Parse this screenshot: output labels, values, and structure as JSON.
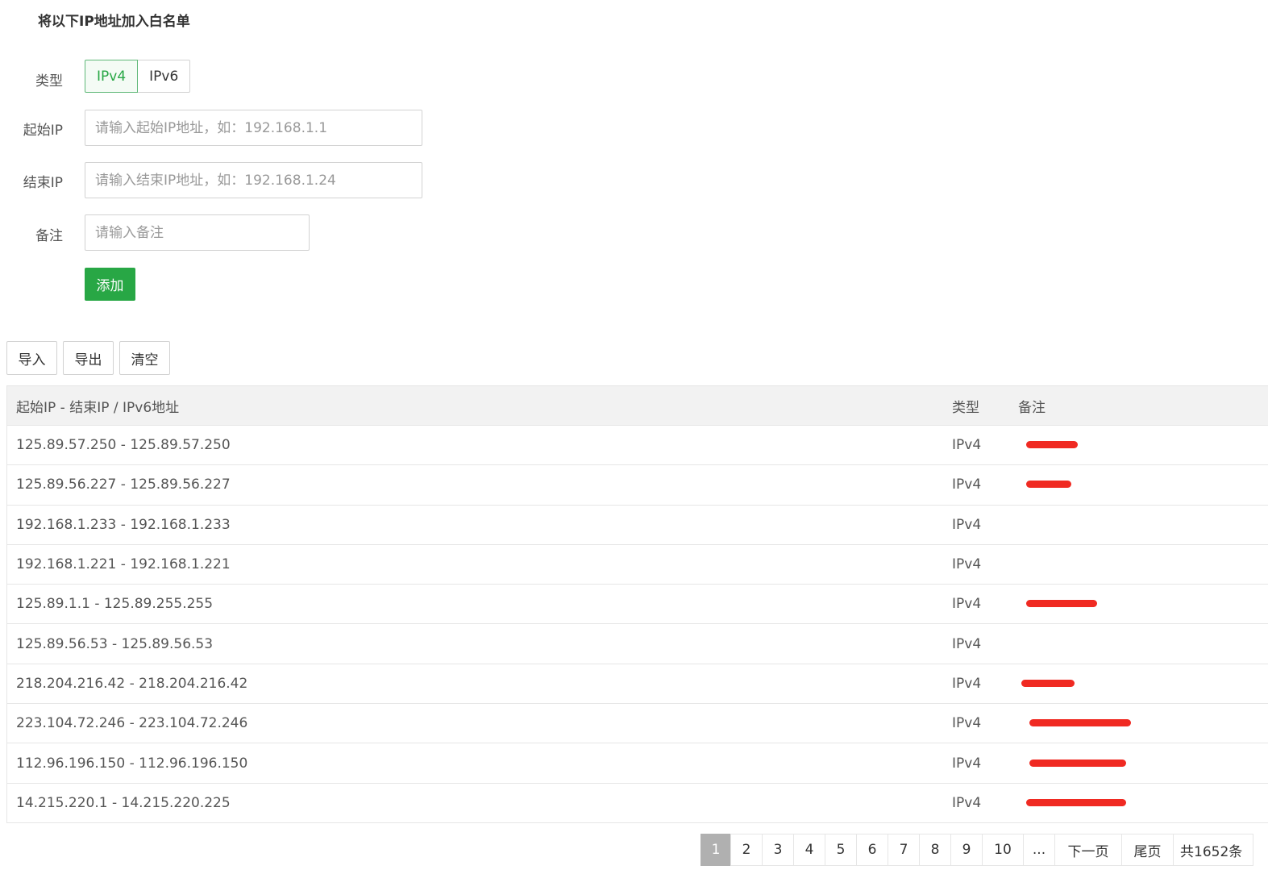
{
  "form": {
    "title": "将以下IP地址加入白名单",
    "type_label": "类型",
    "type_options": [
      "IPv4",
      "IPv6"
    ],
    "selected_type": "IPv4",
    "start_label": "起始IP",
    "start_placeholder": "请输入起始IP地址，如：192.168.1.1",
    "end_label": "结束IP",
    "end_placeholder": "请输入结束IP地址，如：192.168.1.24",
    "note_label": "备注",
    "note_placeholder": "请输入备注",
    "add_label": "添加"
  },
  "toolbar": {
    "import_label": "导入",
    "export_label": "导出",
    "clear_label": "清空"
  },
  "table": {
    "headers": [
      "起始IP - 结束IP / IPv6地址",
      "类型",
      "备注"
    ],
    "rows": [
      {
        "range": "125.89.57.250 - 125.89.57.250",
        "type": "IPv4"
      },
      {
        "range": "125.89.56.227 - 125.89.56.227",
        "type": "IPv4"
      },
      {
        "range": "192.168.1.233 - 192.168.1.233",
        "type": "IPv4"
      },
      {
        "range": "192.168.1.221 - 192.168.1.221",
        "type": "IPv4"
      },
      {
        "range": "125.89.1.1 - 125.89.255.255",
        "type": "IPv4"
      },
      {
        "range": "125.89.56.53 - 125.89.56.53",
        "type": "IPv4"
      },
      {
        "range": "218.204.216.42 - 218.204.216.42",
        "type": "IPv4"
      },
      {
        "range": "223.104.72.246 - 223.104.72.246",
        "type": "IPv4"
      },
      {
        "range": "112.96.196.150 - 112.96.196.150",
        "type": "IPv4"
      },
      {
        "range": "14.215.220.1 - 14.215.220.225",
        "type": "IPv4"
      }
    ]
  },
  "pagination": {
    "pages": [
      "1",
      "2",
      "3",
      "4",
      "5",
      "6",
      "7",
      "8",
      "9",
      "10",
      "..."
    ],
    "current": "1",
    "next_label": "下一页",
    "last_label": "尾页",
    "total_label": "共1652条"
  },
  "colors": {
    "accent_green": "#28a745",
    "redaction": "#f02a22"
  }
}
